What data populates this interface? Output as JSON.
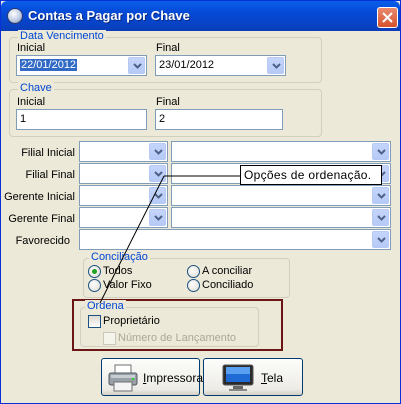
{
  "window": {
    "title": "Contas a Pagar por Chave"
  },
  "data_vencimento": {
    "legend": "Data Vencimento",
    "inicial_label": "Inicial",
    "inicial_value": "22/01/2012",
    "final_label": "Final",
    "final_value": "23/01/2012"
  },
  "chave": {
    "legend": "Chave",
    "inicial_label": "Inicial",
    "inicial_value": "1",
    "final_label": "Final",
    "final_value": "2"
  },
  "filters": {
    "filial_inicial": "Filial Inicial",
    "filial_final": "Filial Final",
    "gerente_inicial": "Gerente Inicial",
    "gerente_final": "Gerente Final",
    "favorecido": "Favorecido"
  },
  "tooltip": {
    "text": "Opções de ordenação."
  },
  "conciliacao": {
    "legend": "Conciliação",
    "options": [
      "Todos",
      "A conciliar",
      "Valor Fixo",
      "Conciliado"
    ],
    "selected": "Todos"
  },
  "ordena": {
    "legend": "Ordena",
    "proprietario": "Proprietário",
    "numero_lancamento": "Número de Lançamento"
  },
  "buttons": {
    "impressora_prefix": "",
    "impressora_key": "I",
    "impressora_rest": "mpressora",
    "tela_key": "T",
    "tela_rest": "ela"
  },
  "colors": {
    "accent": "#0046D5",
    "title_bar": "#0054E3",
    "callout_border": "#6B1515",
    "radio_dot": "#21A121"
  }
}
